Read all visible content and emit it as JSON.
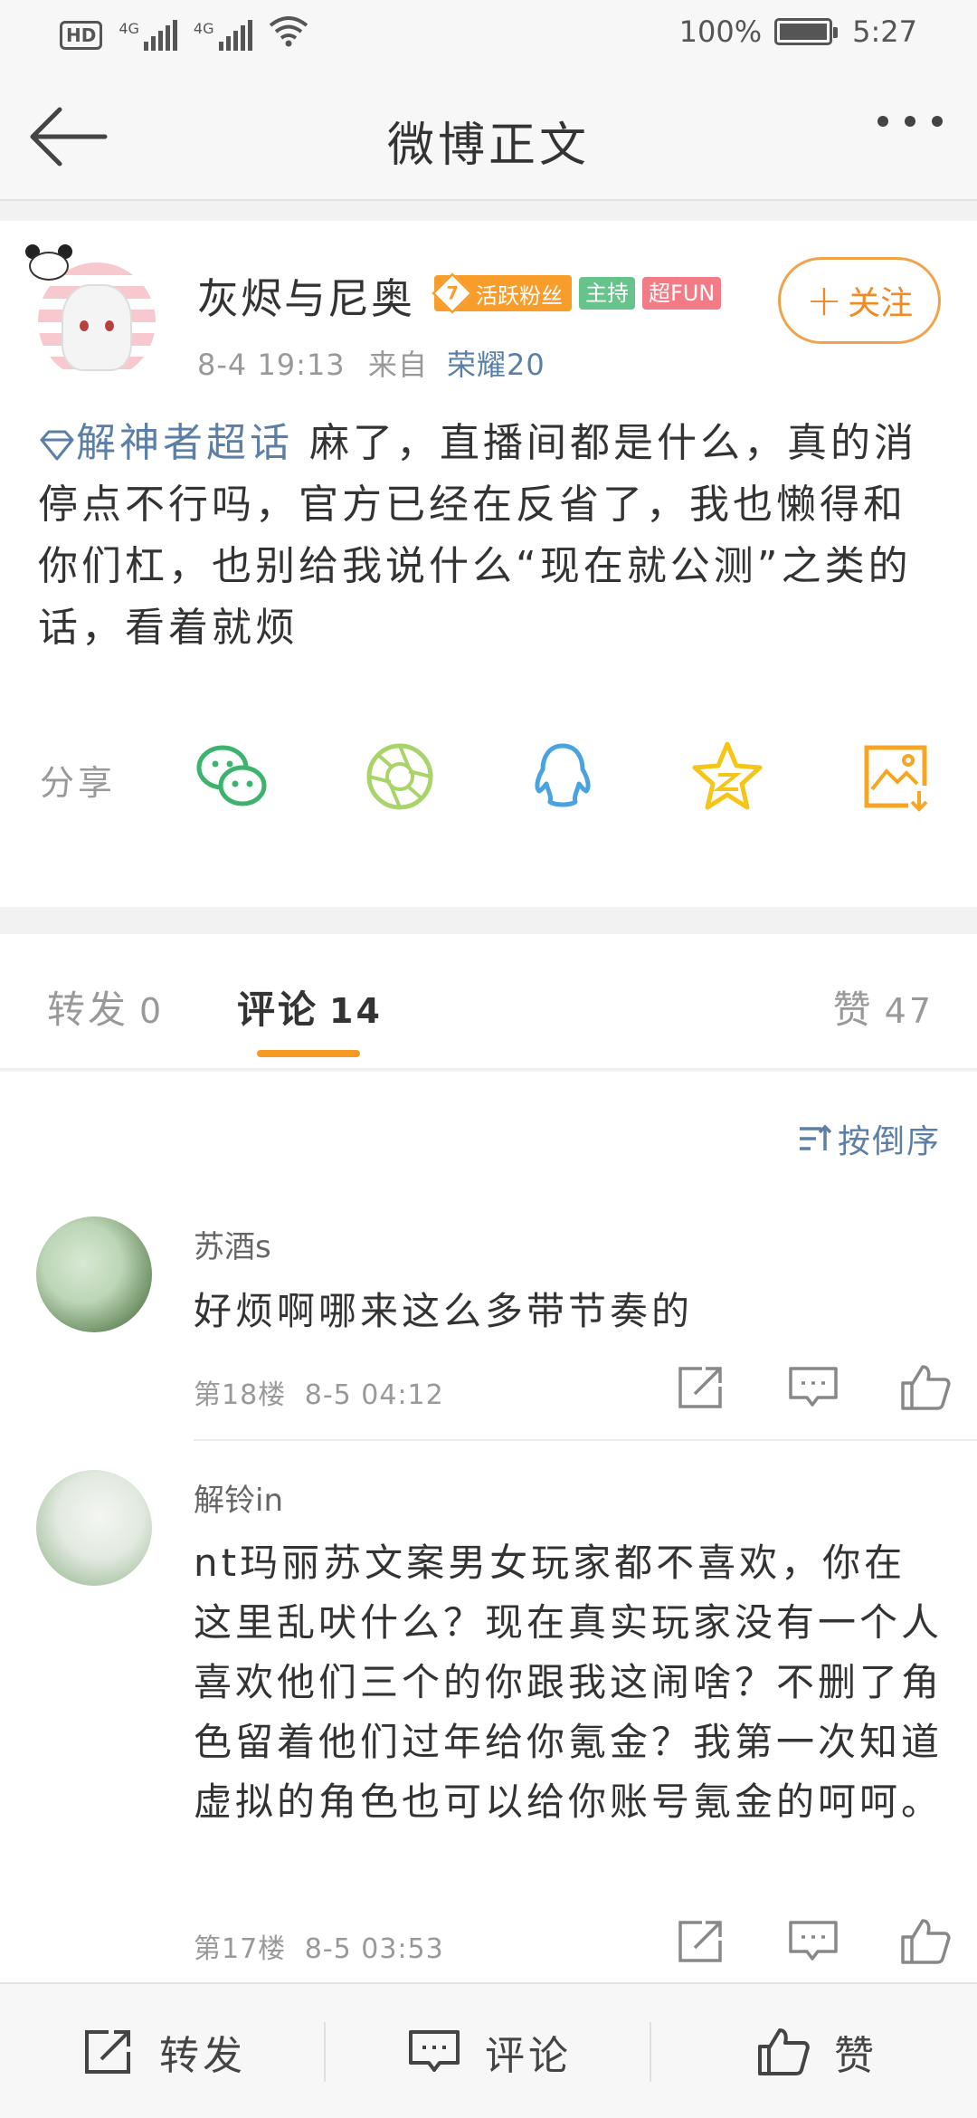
{
  "status_bar": {
    "hd": "HD",
    "sim1": "4G",
    "sim2": "4G",
    "battery_percent": "100%",
    "time": "5:27"
  },
  "nav": {
    "title": "微博正文"
  },
  "post": {
    "username": "灰烬与尼奥",
    "fan_level": "7",
    "fan_badge": "活跃粉丝",
    "host_badge": "主持",
    "fun_badge": "超FUN",
    "date": "8-4 19:13",
    "from_label": "来自",
    "source": "荣耀20",
    "follow_label": "关注",
    "topic": "解神者超话",
    "text": "麻了，直播间都是什么，真的消停点不行吗，官方已经在反省了，我也懒得和你们杠，也别给我说什么“现在就公测”之类的话，看着就烦",
    "share_label": "分享"
  },
  "share_icons": [
    "wechat-icon",
    "moments-icon",
    "qq-icon",
    "qzone-icon",
    "save-image-icon"
  ],
  "tabs": {
    "repost": {
      "label": "转发",
      "count": "0"
    },
    "comment": {
      "label": "评论",
      "count": "14"
    },
    "like": {
      "label": "赞",
      "count": "47"
    }
  },
  "sort_label": "按倒序",
  "comments": [
    {
      "name": "苏酒s",
      "text": "好烦啊哪来这么多带节奏的",
      "floor": "第18楼",
      "time": "8-5 04:12"
    },
    {
      "name": "解铃in",
      "text": "nt玛丽苏文案男女玩家都不喜欢，你在这里乱吠什么？现在真实玩家没有一个人喜欢他们三个的你跟我这闹啥？不删了角色留着他们过年给你氪金？我第一次知道虚拟的角色也可以给你账号氪金的呵呵。",
      "floor": "第17楼",
      "time": "8-5 03:53"
    }
  ],
  "bottom_bar": {
    "repost": "转发",
    "comment": "评论",
    "like": "赞"
  },
  "colors": {
    "accent_orange": "#f59a23",
    "link_blue": "#5b7fa6",
    "wechat_green": "#3cb46e",
    "moments_green": "#a8d46a",
    "qq_blue": "#4aa3df",
    "qzone_yellow": "#f5c518",
    "save_orange": "#f5a623"
  }
}
